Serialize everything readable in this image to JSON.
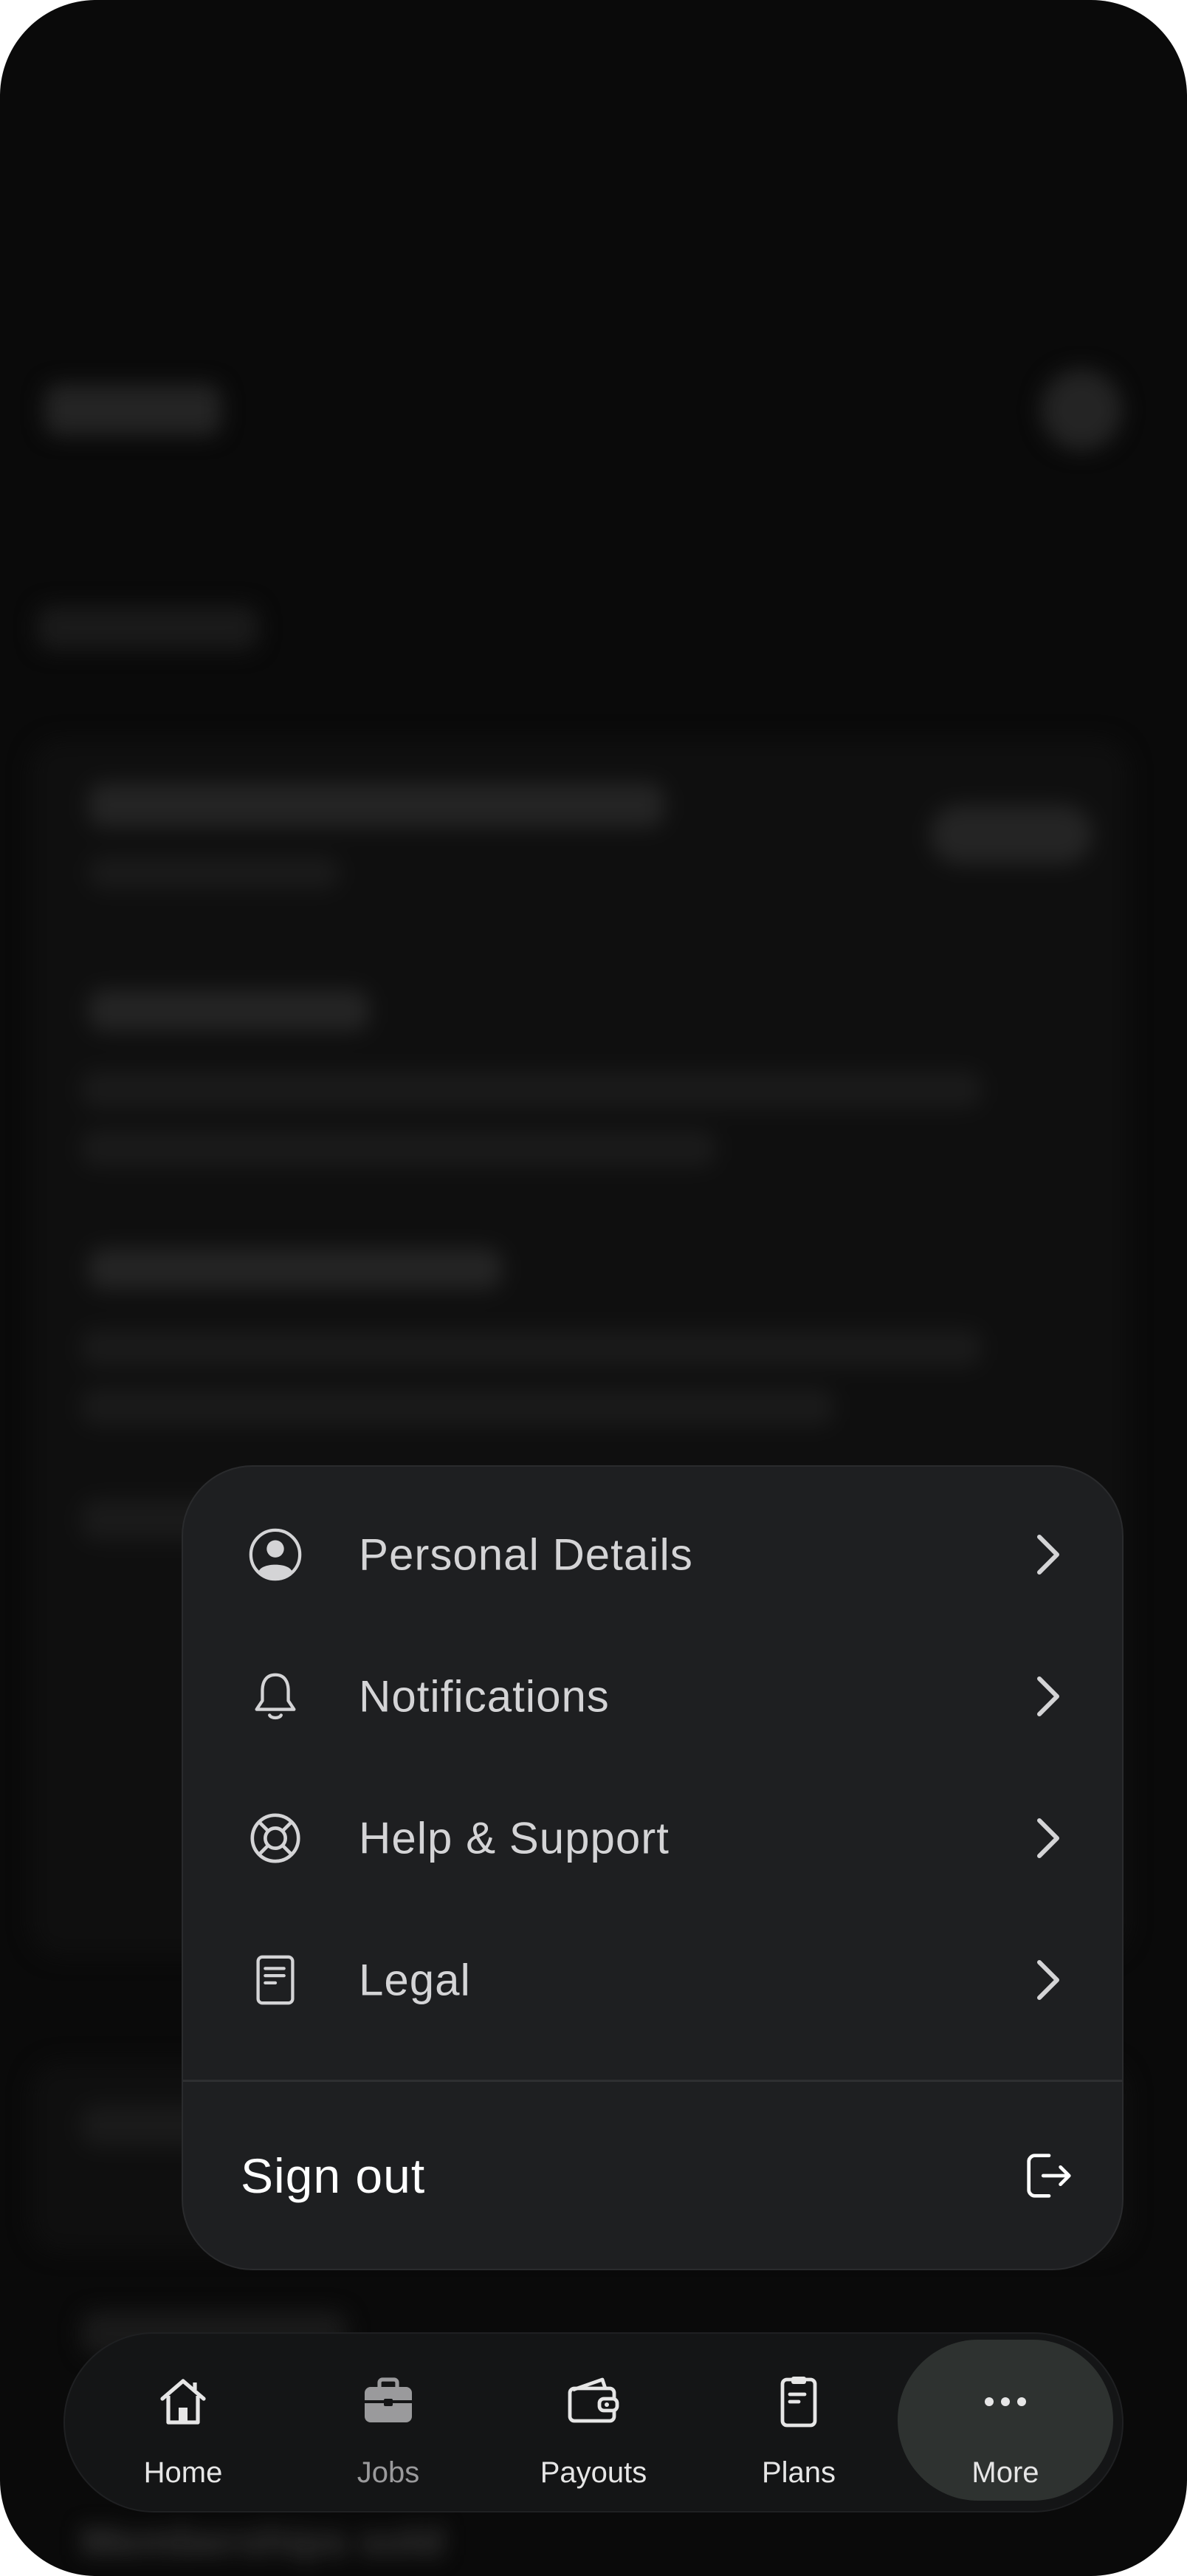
{
  "menu": {
    "items": [
      {
        "label": "Personal Details",
        "icon": "person-circle-icon"
      },
      {
        "label": "Notifications",
        "icon": "bell-icon"
      },
      {
        "label": "Help & Support",
        "icon": "lifebuoy-icon"
      },
      {
        "label": "Legal",
        "icon": "document-icon"
      }
    ],
    "sign_out": {
      "label": "Sign out",
      "icon": "sign-out-icon"
    }
  },
  "tabbar": {
    "tabs": [
      {
        "label": "Home",
        "icon": "home-icon",
        "active": false
      },
      {
        "label": "Jobs",
        "icon": "briefcase-icon",
        "active": false
      },
      {
        "label": "Payouts",
        "icon": "wallet-icon",
        "active": false
      },
      {
        "label": "Plans",
        "icon": "clipboard-icon",
        "active": false
      },
      {
        "label": "More",
        "icon": "more-dots-icon",
        "active": true
      }
    ]
  },
  "background": {
    "bottom_label": "Memberships sold"
  },
  "colors": {
    "menu_bg": "#1e1f21",
    "screen_bg": "#0a0a0a",
    "active_pill": "#2e3230"
  }
}
